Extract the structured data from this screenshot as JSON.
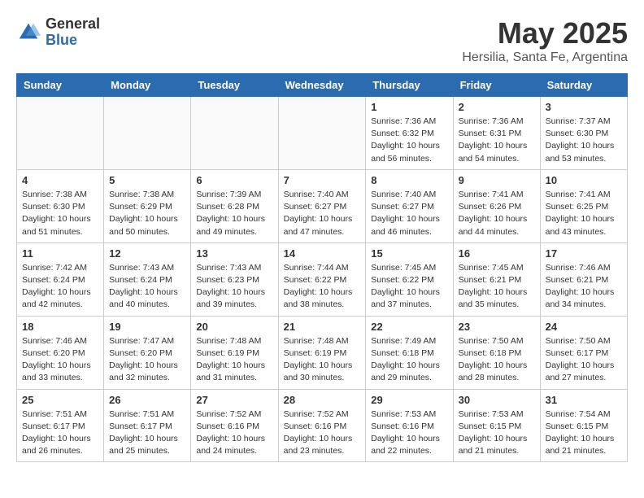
{
  "header": {
    "logo_general": "General",
    "logo_blue": "Blue",
    "month_title": "May 2025",
    "location": "Hersilia, Santa Fe, Argentina"
  },
  "days_of_week": [
    "Sunday",
    "Monday",
    "Tuesday",
    "Wednesday",
    "Thursday",
    "Friday",
    "Saturday"
  ],
  "weeks": [
    [
      {
        "day": "",
        "info": ""
      },
      {
        "day": "",
        "info": ""
      },
      {
        "day": "",
        "info": ""
      },
      {
        "day": "",
        "info": ""
      },
      {
        "day": "1",
        "info": "Sunrise: 7:36 AM\nSunset: 6:32 PM\nDaylight: 10 hours and 56 minutes."
      },
      {
        "day": "2",
        "info": "Sunrise: 7:36 AM\nSunset: 6:31 PM\nDaylight: 10 hours and 54 minutes."
      },
      {
        "day": "3",
        "info": "Sunrise: 7:37 AM\nSunset: 6:30 PM\nDaylight: 10 hours and 53 minutes."
      }
    ],
    [
      {
        "day": "4",
        "info": "Sunrise: 7:38 AM\nSunset: 6:30 PM\nDaylight: 10 hours and 51 minutes."
      },
      {
        "day": "5",
        "info": "Sunrise: 7:38 AM\nSunset: 6:29 PM\nDaylight: 10 hours and 50 minutes."
      },
      {
        "day": "6",
        "info": "Sunrise: 7:39 AM\nSunset: 6:28 PM\nDaylight: 10 hours and 49 minutes."
      },
      {
        "day": "7",
        "info": "Sunrise: 7:40 AM\nSunset: 6:27 PM\nDaylight: 10 hours and 47 minutes."
      },
      {
        "day": "8",
        "info": "Sunrise: 7:40 AM\nSunset: 6:27 PM\nDaylight: 10 hours and 46 minutes."
      },
      {
        "day": "9",
        "info": "Sunrise: 7:41 AM\nSunset: 6:26 PM\nDaylight: 10 hours and 44 minutes."
      },
      {
        "day": "10",
        "info": "Sunrise: 7:41 AM\nSunset: 6:25 PM\nDaylight: 10 hours and 43 minutes."
      }
    ],
    [
      {
        "day": "11",
        "info": "Sunrise: 7:42 AM\nSunset: 6:24 PM\nDaylight: 10 hours and 42 minutes."
      },
      {
        "day": "12",
        "info": "Sunrise: 7:43 AM\nSunset: 6:24 PM\nDaylight: 10 hours and 40 minutes."
      },
      {
        "day": "13",
        "info": "Sunrise: 7:43 AM\nSunset: 6:23 PM\nDaylight: 10 hours and 39 minutes."
      },
      {
        "day": "14",
        "info": "Sunrise: 7:44 AM\nSunset: 6:22 PM\nDaylight: 10 hours and 38 minutes."
      },
      {
        "day": "15",
        "info": "Sunrise: 7:45 AM\nSunset: 6:22 PM\nDaylight: 10 hours and 37 minutes."
      },
      {
        "day": "16",
        "info": "Sunrise: 7:45 AM\nSunset: 6:21 PM\nDaylight: 10 hours and 35 minutes."
      },
      {
        "day": "17",
        "info": "Sunrise: 7:46 AM\nSunset: 6:21 PM\nDaylight: 10 hours and 34 minutes."
      }
    ],
    [
      {
        "day": "18",
        "info": "Sunrise: 7:46 AM\nSunset: 6:20 PM\nDaylight: 10 hours and 33 minutes."
      },
      {
        "day": "19",
        "info": "Sunrise: 7:47 AM\nSunset: 6:20 PM\nDaylight: 10 hours and 32 minutes."
      },
      {
        "day": "20",
        "info": "Sunrise: 7:48 AM\nSunset: 6:19 PM\nDaylight: 10 hours and 31 minutes."
      },
      {
        "day": "21",
        "info": "Sunrise: 7:48 AM\nSunset: 6:19 PM\nDaylight: 10 hours and 30 minutes."
      },
      {
        "day": "22",
        "info": "Sunrise: 7:49 AM\nSunset: 6:18 PM\nDaylight: 10 hours and 29 minutes."
      },
      {
        "day": "23",
        "info": "Sunrise: 7:50 AM\nSunset: 6:18 PM\nDaylight: 10 hours and 28 minutes."
      },
      {
        "day": "24",
        "info": "Sunrise: 7:50 AM\nSunset: 6:17 PM\nDaylight: 10 hours and 27 minutes."
      }
    ],
    [
      {
        "day": "25",
        "info": "Sunrise: 7:51 AM\nSunset: 6:17 PM\nDaylight: 10 hours and 26 minutes."
      },
      {
        "day": "26",
        "info": "Sunrise: 7:51 AM\nSunset: 6:17 PM\nDaylight: 10 hours and 25 minutes."
      },
      {
        "day": "27",
        "info": "Sunrise: 7:52 AM\nSunset: 6:16 PM\nDaylight: 10 hours and 24 minutes."
      },
      {
        "day": "28",
        "info": "Sunrise: 7:52 AM\nSunset: 6:16 PM\nDaylight: 10 hours and 23 minutes."
      },
      {
        "day": "29",
        "info": "Sunrise: 7:53 AM\nSunset: 6:16 PM\nDaylight: 10 hours and 22 minutes."
      },
      {
        "day": "30",
        "info": "Sunrise: 7:53 AM\nSunset: 6:15 PM\nDaylight: 10 hours and 21 minutes."
      },
      {
        "day": "31",
        "info": "Sunrise: 7:54 AM\nSunset: 6:15 PM\nDaylight: 10 hours and 21 minutes."
      }
    ]
  ]
}
